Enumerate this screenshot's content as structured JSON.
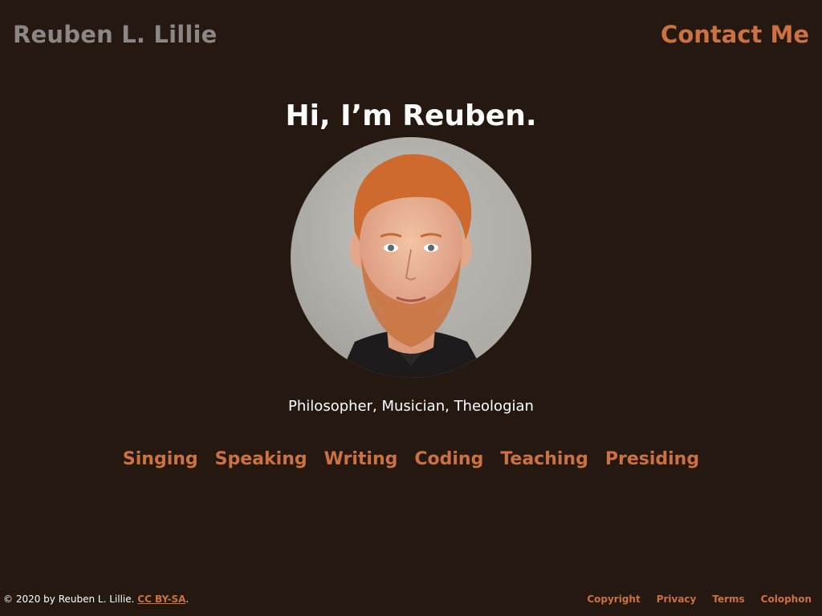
{
  "header": {
    "site_title": "Reuben L. Lillie",
    "contact_label": "Contact Me"
  },
  "hero": {
    "headline": "Hi, I’m Reuben.",
    "portrait_alt": "Portrait of Reuben L. Lillie",
    "tagline": "Philosopher, Musician, Theologian"
  },
  "skills": [
    {
      "label": "Singing"
    },
    {
      "label": "Speaking"
    },
    {
      "label": "Writing"
    },
    {
      "label": "Coding"
    },
    {
      "label": "Teaching"
    },
    {
      "label": "Presiding"
    }
  ],
  "footer": {
    "copyright_text": "© 2020 by Reuben L. Lillie. ",
    "license_label": "CC BY-SA",
    "trailing_period": ".",
    "links": [
      {
        "label": "Copyright"
      },
      {
        "label": "Privacy"
      },
      {
        "label": "Terms"
      },
      {
        "label": "Colophon"
      }
    ]
  },
  "colors": {
    "background": "#241810",
    "accent": "#cc7240",
    "title_gray": "#8a8785",
    "text": "#ffffff"
  }
}
